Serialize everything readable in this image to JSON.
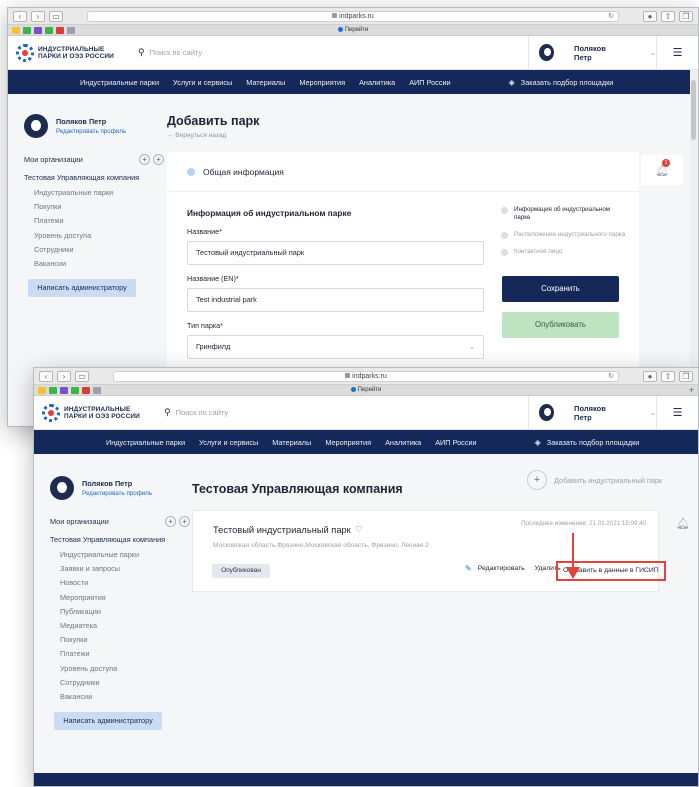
{
  "browser": {
    "url": "indparks.ru",
    "tab_title": "Перейти"
  },
  "header": {
    "logo_line1": "ИНДУСТРИАЛЬНЫЕ",
    "logo_line2": "ПАРКИ И ОЭЗ РОССИИ",
    "search_placeholder": "Поиск по сайту",
    "user_name": "Поляков Петр"
  },
  "nav": {
    "items": [
      "Индустриальные парки",
      "Услуги и сервисы",
      "Материалы",
      "Мероприятия",
      "Аналитика",
      "АИП России"
    ],
    "order_label": "Заказать подбор площадки"
  },
  "sidebar": {
    "name": "Поляков Петр",
    "edit_profile": "Редактировать профиль",
    "orgs_label": "Мои организации",
    "company": "Тестовая Управляющая компания",
    "admin_button": "Написать администратору"
  },
  "screen1": {
    "menu": [
      "Индустриальные парки",
      "Покупки",
      "Платежи",
      "Уровень доступа",
      "Сотрудники",
      "Вакансии"
    ],
    "page_title": "Добавить парк",
    "back_link": "← Вернуться назад",
    "section_header": "Общая информация",
    "form_title": "Информация об индустриальном парке",
    "fields": [
      {
        "label": "Название*",
        "value": "Тестовый индустриальный парк"
      },
      {
        "label": "Название (EN)*",
        "value": "Test industrial park"
      },
      {
        "label": "Тип парка*",
        "value": "Гринфилд"
      }
    ],
    "steps": [
      "Информация об индустриальном парке",
      "Расположение индустриального парка",
      "Контактное лицо"
    ],
    "save_button": "Сохранить",
    "publish_button": "Опубликовать",
    "notification_count": "1"
  },
  "screen2": {
    "menu": [
      "Индустриальные парки",
      "Заявки и запросы",
      "Новости",
      "Мероприятия",
      "Публикации",
      "Медиатека",
      "Покупки",
      "Платежи",
      "Уровень доступа",
      "Сотрудники",
      "Вакансии"
    ],
    "company_title": "Тестовая Управляющая компания",
    "add_park": "Добавить индустриальный парк",
    "park": {
      "name": "Тестовый индустриальный парк",
      "address": "Московская область,Фрязино,Московская область, Фрязино, Лесная 2",
      "last_change": "Последнее изменение: 21.01.2021 15:09:40",
      "status": "Опубликован",
      "edit": "Редактировать",
      "delete": "Удалить",
      "send_gisip": "Отправить в данные в ГИСИП"
    }
  },
  "colors": {
    "navy": "#14285a",
    "accent_blue": "#2766c6",
    "highlight_red": "#e2433c",
    "publish_green": "#bfe4c2"
  }
}
